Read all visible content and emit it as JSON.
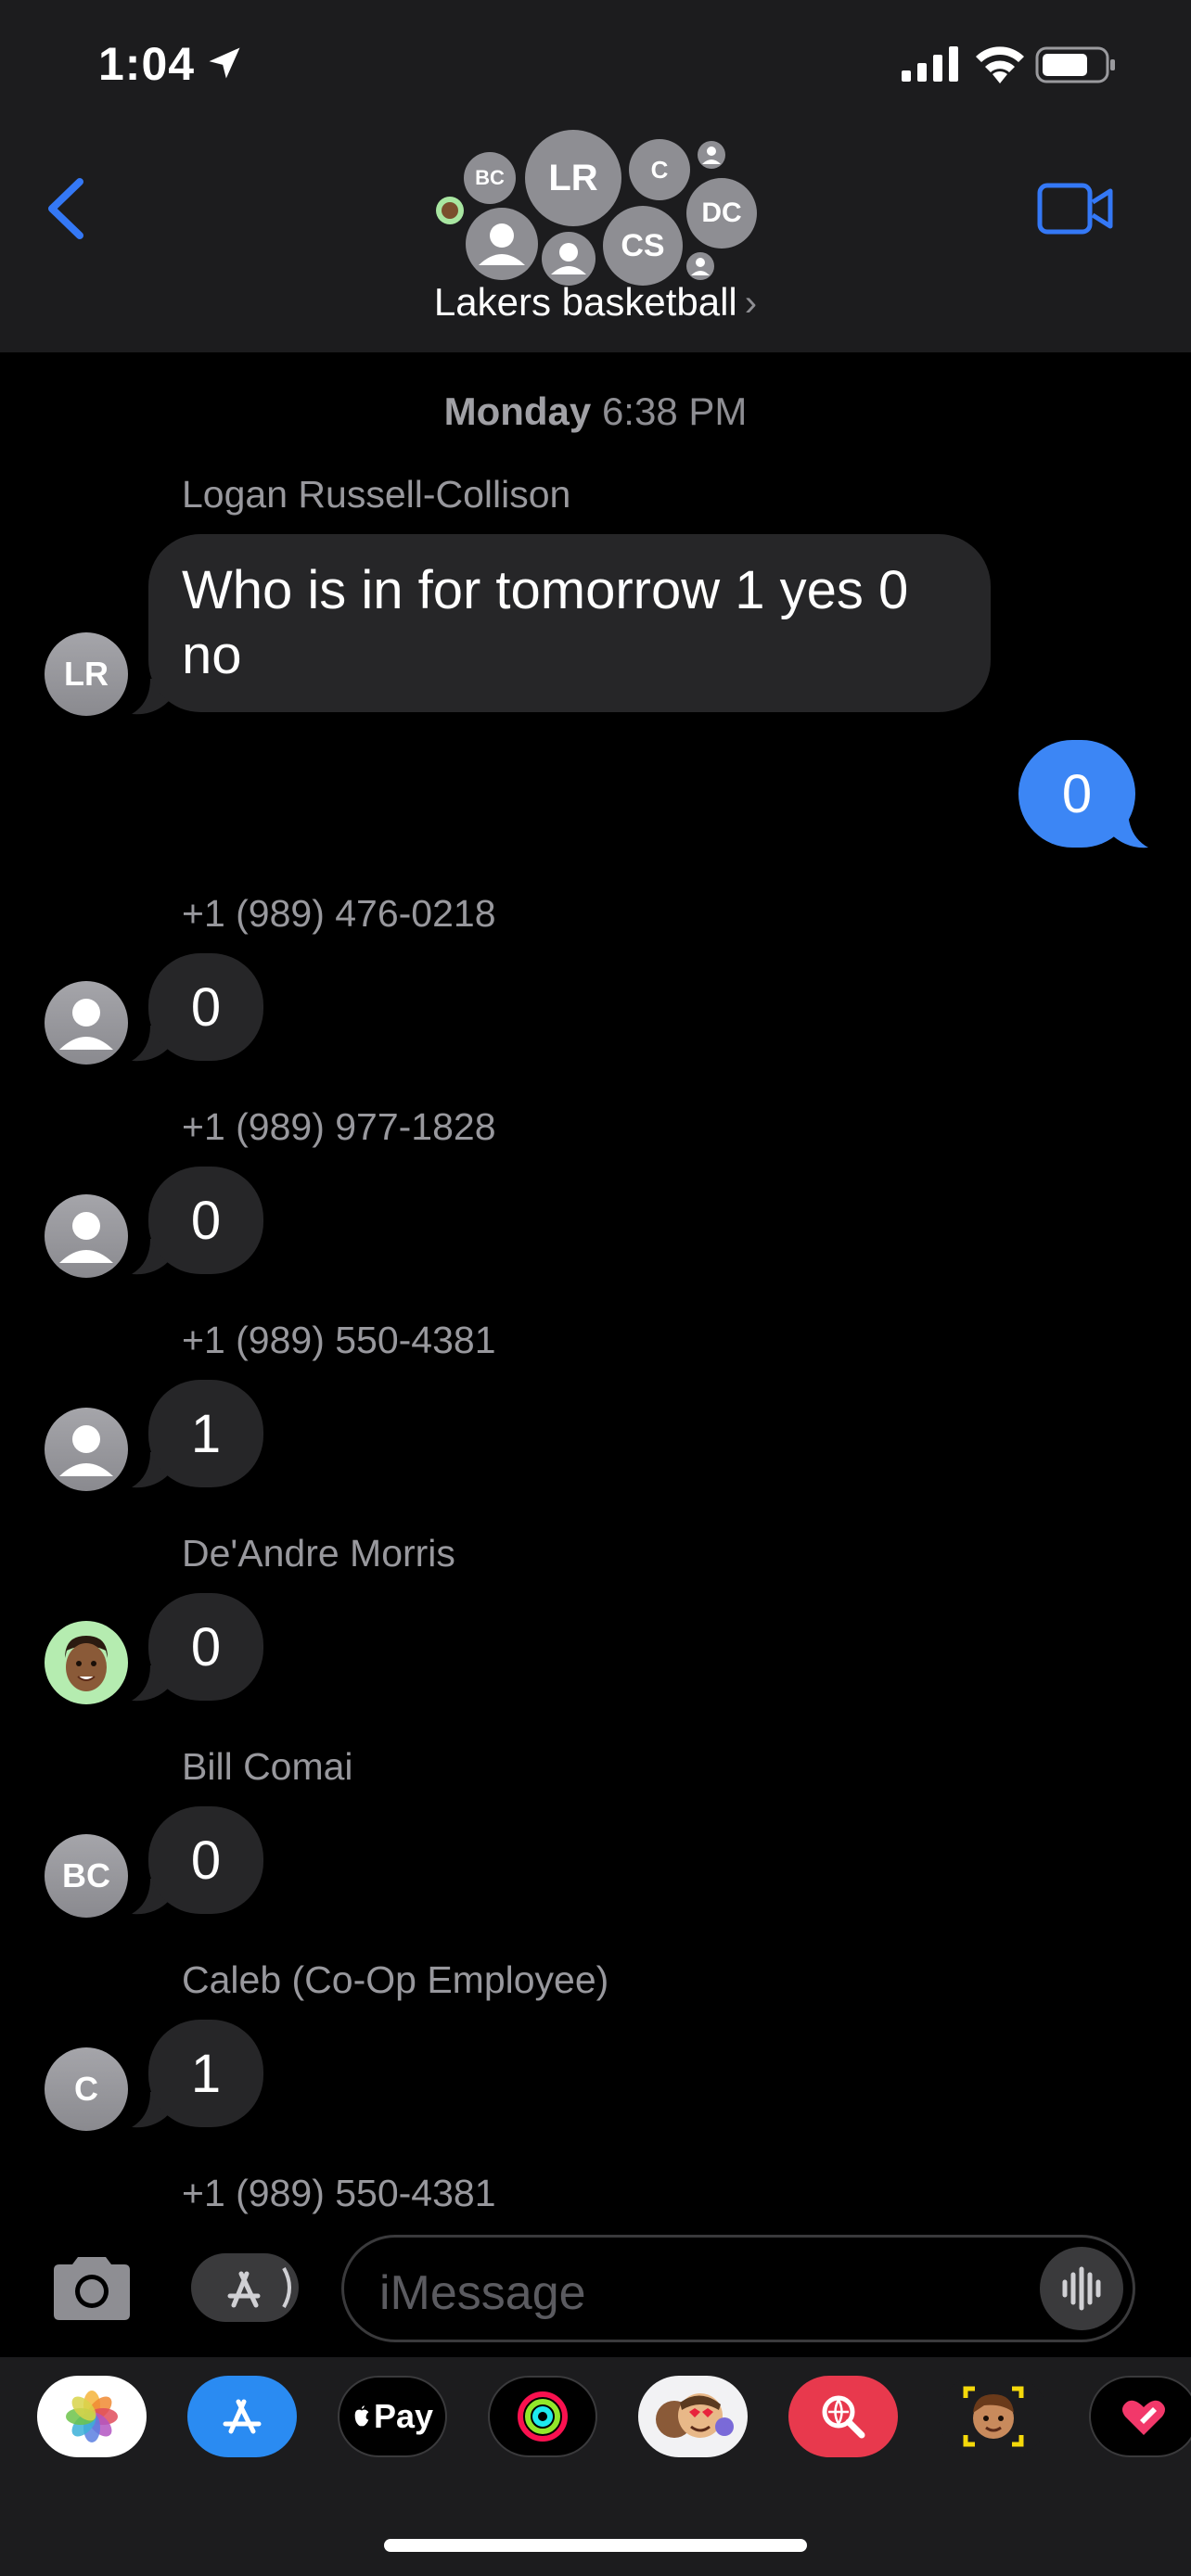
{
  "status_bar": {
    "time": "1:04"
  },
  "header": {
    "group_name": "Lakers basketball",
    "chevron": "›",
    "group_avatars": [
      {
        "initials": "BC"
      },
      {
        "initials": "LR"
      },
      {
        "initials": "C"
      },
      {
        "initials": "DC"
      },
      {
        "initials": "CS"
      }
    ]
  },
  "conversation": {
    "timestamp_day": "Monday",
    "timestamp_time": "6:38 PM",
    "messages": [
      {
        "sender": "Logan Russell-Collison",
        "avatar": "LR",
        "text": "Who is in for tomorrow 1 yes 0 no"
      },
      {
        "sender": "Me",
        "text": "0",
        "outgoing": true
      },
      {
        "sender": "+1 (989) 476-0218",
        "avatar": "person-icon",
        "text": "0"
      },
      {
        "sender": "+1 (989) 977-1828",
        "avatar": "person-icon",
        "text": "0"
      },
      {
        "sender": "+1 (989) 550-4381",
        "avatar": "person-icon",
        "text": "1"
      },
      {
        "sender": "De'Andre Morris",
        "avatar": "memoji-icon",
        "text": "0"
      },
      {
        "sender": "Bill Comai",
        "avatar": "BC",
        "text": "0"
      },
      {
        "sender": "Caleb (Co-Op Employee)",
        "avatar": "C",
        "text": "1"
      },
      {
        "sender": "+1 (989) 550-4381"
      }
    ]
  },
  "input": {
    "placeholder": "iMessage"
  },
  "app_drawer": {
    "apps": [
      "photos-icon",
      "app-store-icon",
      "apple-pay-icon",
      "activity-icon",
      "memoji-stickers-icon",
      "image-search-icon",
      "memoji-icon",
      "digital-touch-icon"
    ],
    "apple_pay_label": "Pay"
  },
  "colors": {
    "outgoing_bubble": "#3c86f5",
    "incoming_bubble": "#262628",
    "accent": "#3478f6"
  }
}
